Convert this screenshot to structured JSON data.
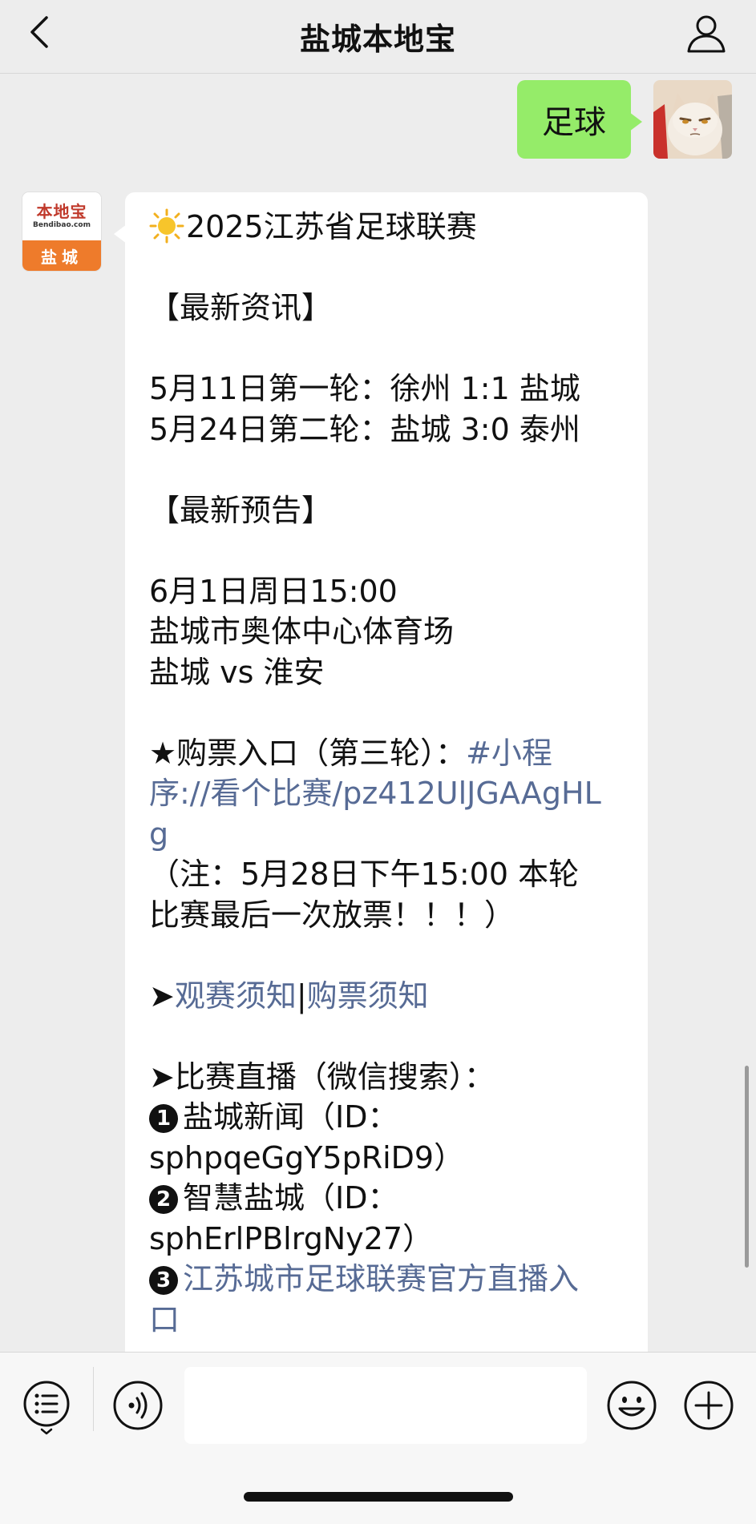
{
  "header": {
    "title": "盐城本地宝"
  },
  "outgoing": {
    "text": "足球"
  },
  "incoming_avatar": {
    "logo_text": "本地宝",
    "logo_sub": "Bendibao.com",
    "city": "盐城"
  },
  "message": {
    "title": "2025江苏省足球联赛",
    "news_heading": "【最新资讯】",
    "news_1": "5月11日第一轮：徐州 1:1 盐城",
    "news_2": "5月24日第二轮：盐城 3:0 泰州",
    "preview_heading": "【最新预告】",
    "preview_time": "6月1日周日15:00",
    "preview_venue": "盐城市奥体中心体育场",
    "preview_match": "盐城 vs 淮安",
    "ticket_prefix": "★购票入口（第三轮）：",
    "ticket_link_1": "#小程",
    "ticket_link_2": "序://看个比赛/pz412UlJGAAgHL",
    "ticket_link_3": "g",
    "note_1": "（注：5月28日下午15:00 本轮",
    "note_2": "比赛最后一次放票！！！）",
    "arrow": "➤",
    "watch_rules": "观赛须知",
    "sep": "|",
    "buy_rules": "购票须知",
    "live_heading": "➤比赛直播（微信搜索）：",
    "live_1_num": "1",
    "live_1_name": "盐城新闻（ID：",
    "live_1_id": "sphpqeGgY5pRiD9）",
    "live_2_num": "2",
    "live_2_name": "智慧盐城（ID：",
    "live_2_id": "sphErlPBlrgNy27）",
    "live_3_num": "3",
    "live_3_link_1": "江苏城市足球联赛官方直播入",
    "live_3_link_2": "口"
  },
  "icons": {
    "back": "chevron-left-icon",
    "profile": "person-icon",
    "sun": "sun-icon",
    "menu": "list-menu-icon",
    "voice": "voice-icon",
    "emoji": "smiley-icon",
    "plus": "plus-icon"
  },
  "colors": {
    "background": "#ededed",
    "outgoing_bubble": "#95ec69",
    "incoming_bubble": "#ffffff",
    "link": "#576b95",
    "logo_orange": "#ee7b2b",
    "logo_red": "#c0392b"
  }
}
